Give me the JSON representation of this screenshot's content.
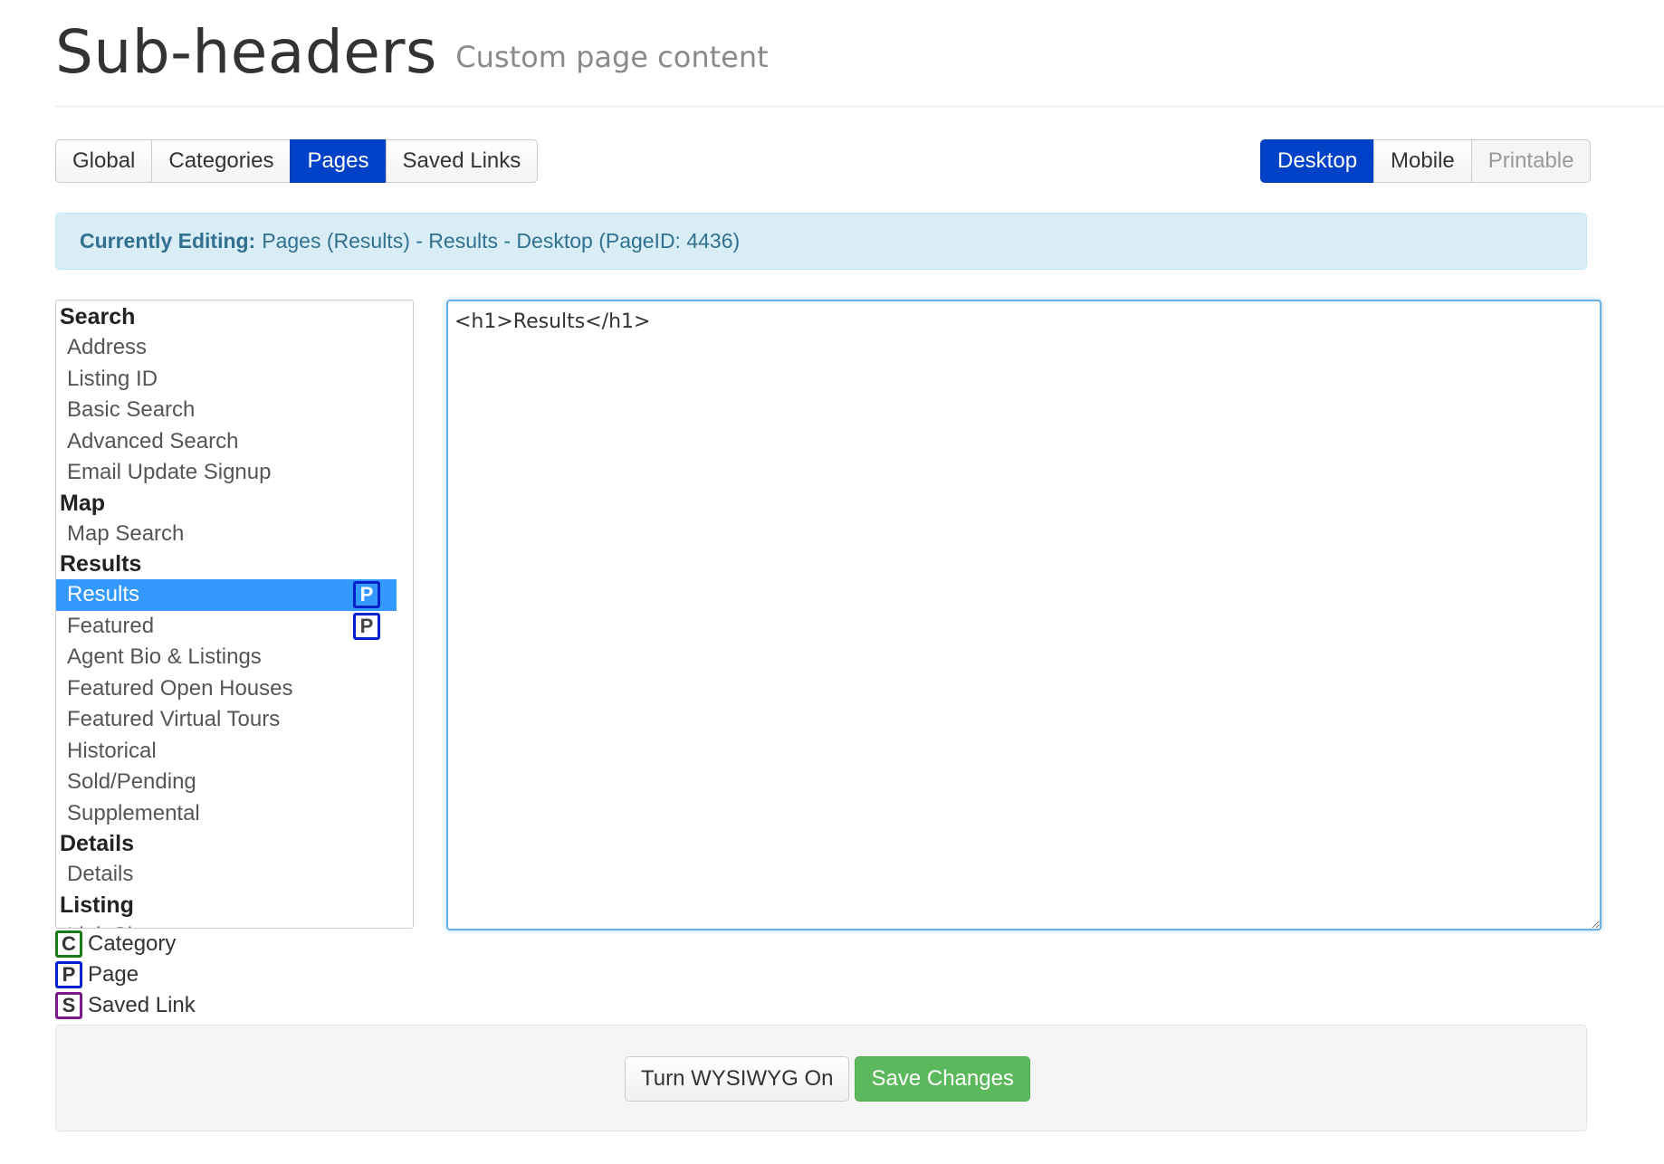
{
  "header": {
    "title": "Sub-headers",
    "subtitle": "Custom page content"
  },
  "type_tabs": [
    {
      "label": "Global",
      "active": false
    },
    {
      "label": "Categories",
      "active": false
    },
    {
      "label": "Pages",
      "active": true
    },
    {
      "label": "Saved Links",
      "active": false
    }
  ],
  "device_tabs": [
    {
      "label": "Desktop",
      "active": true,
      "disabled": false
    },
    {
      "label": "Mobile",
      "active": false,
      "disabled": false
    },
    {
      "label": "Printable",
      "active": false,
      "disabled": true
    }
  ],
  "alert": {
    "label": "Currently Editing:",
    "text": "Pages (Results) - Results - Desktop (PageID: 4436)"
  },
  "page_list": {
    "groups": [
      {
        "header": "Search",
        "items": [
          {
            "label": "Address"
          },
          {
            "label": "Listing ID"
          },
          {
            "label": "Basic Search"
          },
          {
            "label": "Advanced Search"
          },
          {
            "label": "Email Update Signup"
          }
        ]
      },
      {
        "header": "Map",
        "items": [
          {
            "label": "Map Search"
          }
        ]
      },
      {
        "header": "Results",
        "items": [
          {
            "label": "Results",
            "selected": true,
            "badge": "P"
          },
          {
            "label": "Featured",
            "badge": "P"
          },
          {
            "label": "Agent Bio & Listings"
          },
          {
            "label": "Featured Open Houses"
          },
          {
            "label": "Featured Virtual Tours"
          },
          {
            "label": "Historical"
          },
          {
            "label": "Sold/Pending"
          },
          {
            "label": "Supplemental"
          }
        ]
      },
      {
        "header": "Details",
        "items": [
          {
            "label": "Details"
          }
        ]
      },
      {
        "header": "Listing",
        "items": [
          {
            "label": "Link Showcase"
          }
        ]
      }
    ]
  },
  "editor": {
    "content": "<h1>Results</h1>"
  },
  "legend": [
    {
      "letter": "C",
      "label": "Category",
      "color": "#1a7a1a"
    },
    {
      "letter": "P",
      "label": "Page",
      "color": "#0022cc"
    },
    {
      "letter": "S",
      "label": "Saved Link",
      "color": "#7a1a8a"
    }
  ],
  "footer": {
    "wysiwyg_label": "Turn WYSIWYG On",
    "save_label": "Save Changes"
  },
  "colors": {
    "accent": "#0042c7",
    "selected_row": "#3399ff",
    "success": "#5cb85c",
    "info_bg": "#d9edf7",
    "info_text": "#31708f"
  }
}
